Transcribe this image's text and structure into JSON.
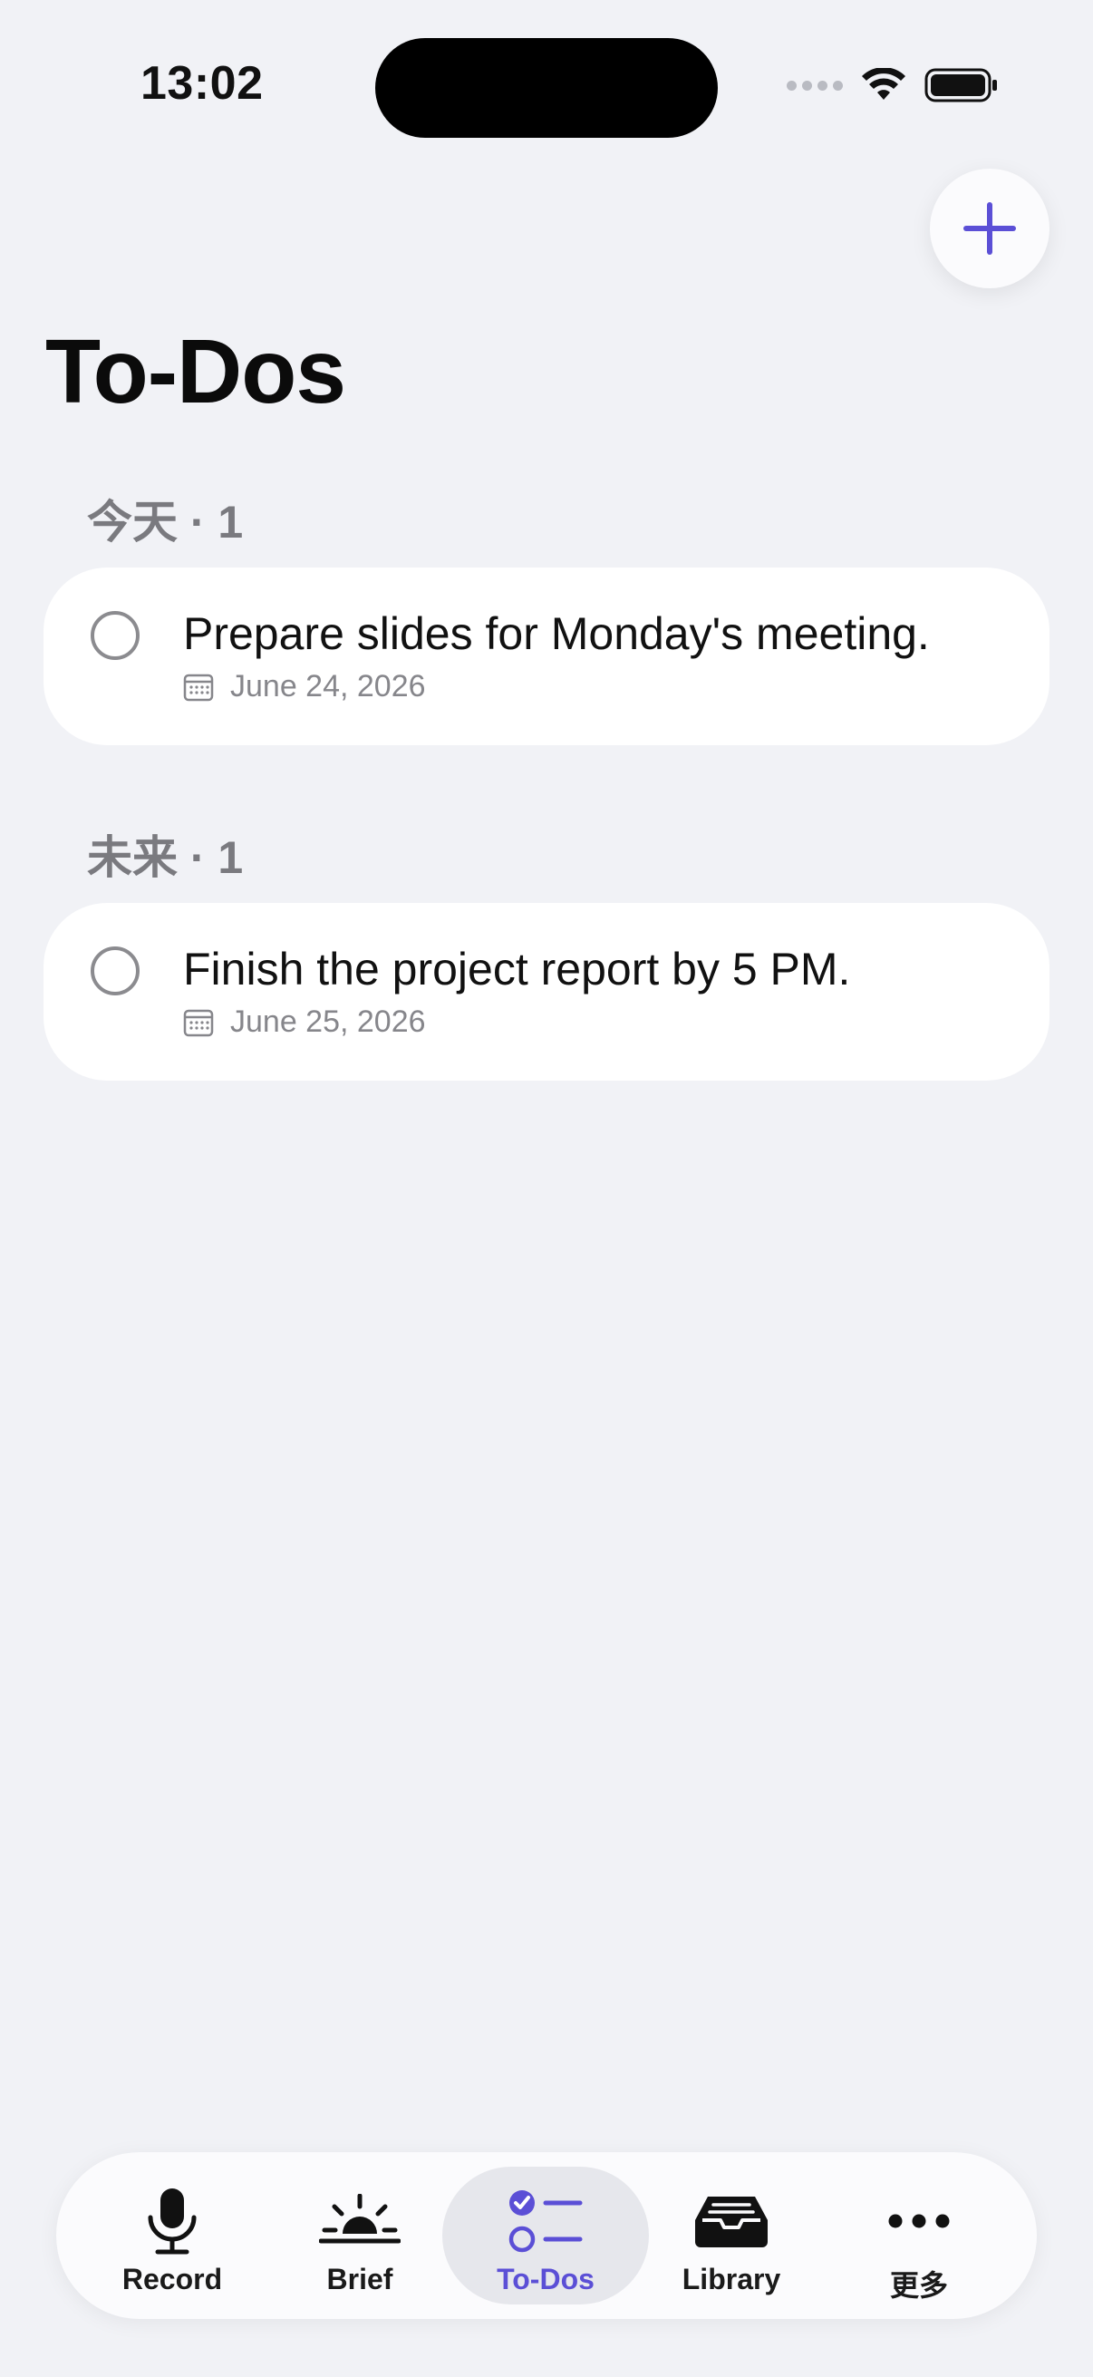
{
  "status_bar": {
    "time": "13:02"
  },
  "header": {
    "title": "To-Dos",
    "add_icon": "plus-icon"
  },
  "sections": [
    {
      "header": "今天 · 1",
      "items": [
        {
          "title": "Prepare slides for Monday's meeting.",
          "date": "June 24, 2026",
          "completed": false
        }
      ]
    },
    {
      "header": "未来 · 1",
      "items": [
        {
          "title": "Finish the project report by 5 PM.",
          "date": "June 25, 2026",
          "completed": false
        }
      ]
    }
  ],
  "tab_bar": {
    "tabs": [
      {
        "label": "Record",
        "icon": "microphone-icon",
        "active": false
      },
      {
        "label": "Brief",
        "icon": "sunrise-icon",
        "active": false
      },
      {
        "label": "To-Dos",
        "icon": "checklist-icon",
        "active": true
      },
      {
        "label": "Library",
        "icon": "inbox-tray-icon",
        "active": false
      },
      {
        "label": "更多",
        "icon": "more-dots-icon",
        "active": false
      }
    ]
  },
  "colors": {
    "accent": "#5b4fd6",
    "background": "#f1f2f6",
    "card": "#ffffff",
    "secondary_text": "#86868b"
  }
}
